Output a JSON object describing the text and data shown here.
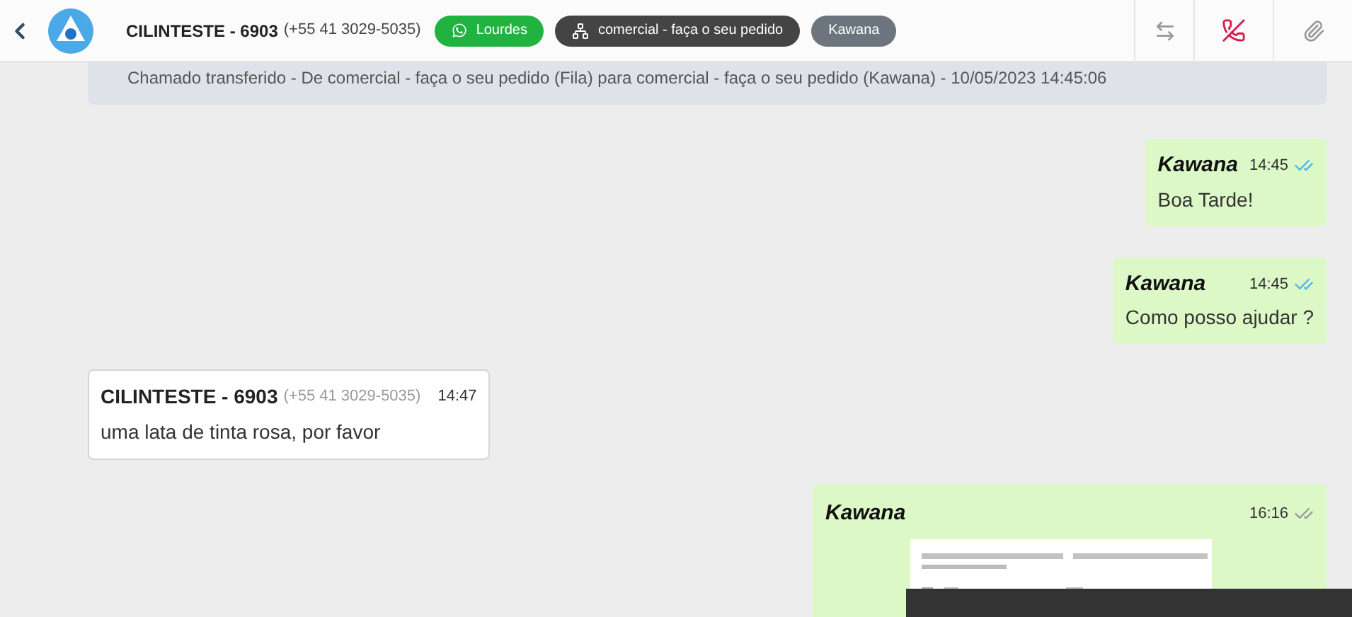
{
  "header": {
    "contact_name": "CILINTESTE - 6903",
    "contact_phone": "(+55 41 3029-5035)",
    "tags": [
      {
        "kind": "whatsapp",
        "label": "Lourdes",
        "color": "#21b33f"
      },
      {
        "kind": "queue",
        "label": "comercial - faça o seu pedido",
        "color": "#444444"
      },
      {
        "kind": "agent",
        "label": "Kawana",
        "color": "#6c757d"
      }
    ]
  },
  "notice": "Chamado transferido - De comercial - faça o seu pedido (Fila) para comercial - faça o seu pedido (Kawana) - 10/05/2023 14:45:06",
  "messages": [
    {
      "kind": "outgoing",
      "author": "Kawana",
      "time": "14:45",
      "text": "Boa Tarde!",
      "read": true
    },
    {
      "kind": "outgoing",
      "author": "Kawana",
      "time": "14:45",
      "text": "Como posso ajudar ?",
      "read": true
    },
    {
      "kind": "incoming",
      "author": "CILINTESTE - 6903",
      "phone": "(+55 41 3029-5035)",
      "time": "14:47",
      "text": "uma lata de tinta rosa, por favor"
    },
    {
      "author": "Kawana",
      "time": "16:16",
      "read": false
    }
  ]
}
